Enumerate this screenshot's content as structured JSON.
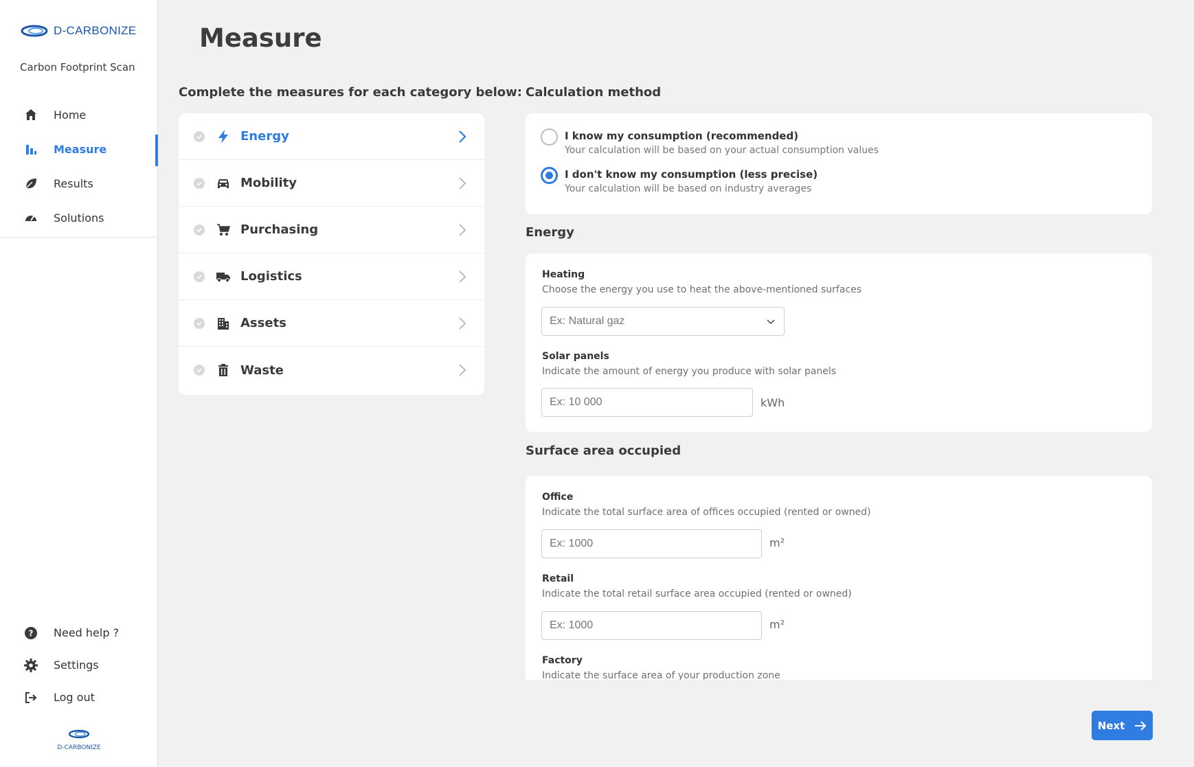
{
  "brand": {
    "name": "D-CARBONIZE",
    "subtitle": "Carbon Footprint Scan",
    "footer_text": "D-CARBONIZE"
  },
  "sidebar": {
    "items": [
      {
        "label": "Home",
        "icon": "home-icon"
      },
      {
        "label": "Measure",
        "icon": "bar-chart-icon",
        "active": true
      },
      {
        "label": "Results",
        "icon": "leaf-icon"
      },
      {
        "label": "Solutions",
        "icon": "gauge-icon"
      }
    ],
    "bottom": [
      {
        "label": "Need help ?",
        "icon": "help-icon"
      },
      {
        "label": "Settings",
        "icon": "gear-icon"
      },
      {
        "label": "Log out",
        "icon": "logout-icon"
      }
    ]
  },
  "page": {
    "title": "Measure"
  },
  "categories": {
    "heading": "Complete the measures for each category below:",
    "items": [
      {
        "label": "Energy",
        "icon": "bolt-icon",
        "active": true
      },
      {
        "label": "Mobility",
        "icon": "car-icon"
      },
      {
        "label": "Purchasing",
        "icon": "cart-icon"
      },
      {
        "label": "Logistics",
        "icon": "truck-icon"
      },
      {
        "label": "Assets",
        "icon": "building-icon"
      },
      {
        "label": "Waste",
        "icon": "trash-icon"
      }
    ]
  },
  "calculation": {
    "heading": "Calculation method",
    "options": [
      {
        "title": "I know my consumption (recommended)",
        "desc": "Your calculation will be based on your actual consumption values",
        "checked": false
      },
      {
        "title": "I don't know my consumption (less precise)",
        "desc": "Your calculation will be based on industry averages",
        "checked": true
      }
    ]
  },
  "energy": {
    "heading": "Energy",
    "heating": {
      "label": "Heating",
      "desc": "Choose the energy you use to heat the above-mentioned surfaces",
      "placeholder": "Ex: Natural gaz"
    },
    "solar": {
      "label": "Solar panels",
      "desc": "Indicate the amount of energy you produce with solar panels",
      "placeholder": "Ex: 10 000",
      "unit": "kWh"
    }
  },
  "surface": {
    "heading": "Surface area occupied",
    "office": {
      "label": "Office",
      "desc": "Indicate the total surface area of offices occupied (rented or owned)",
      "placeholder": "Ex: 1000",
      "unit": "m²"
    },
    "retail": {
      "label": "Retail",
      "desc": "Indicate the total retail surface area occupied (rented or owned)",
      "placeholder": "Ex: 1000",
      "unit": "m²"
    },
    "factory": {
      "label": "Factory",
      "desc": "Indicate the surface area of your production zone"
    }
  },
  "actions": {
    "next_label": "Next"
  },
  "colors": {
    "accent": "#2f7de1",
    "brand": "#1b56a8",
    "background": "#f1f1f1"
  }
}
